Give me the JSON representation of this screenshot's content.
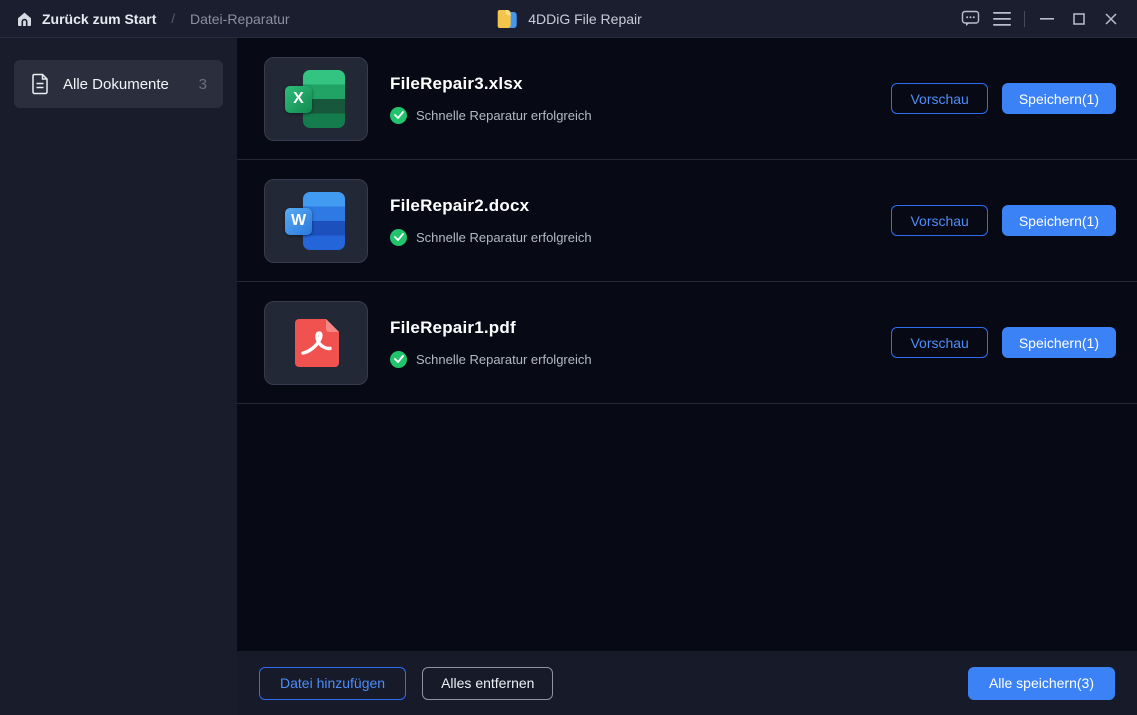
{
  "titlebar": {
    "back_label": "Zurück zum Start",
    "separator": "/",
    "current": "Datei-Reparatur",
    "app_title": "4DDiG File Repair"
  },
  "sidebar": {
    "all_documents_label": "Alle Dokumente",
    "all_documents_count": "3"
  },
  "files": [
    {
      "name": "FileRepair3.xlsx",
      "type": "xlsx",
      "badge_letter": "X",
      "status": "Schnelle Reparatur erfolgreich",
      "preview_label": "Vorschau",
      "save_label": "Speichern(1)"
    },
    {
      "name": "FileRepair2.docx",
      "type": "docx",
      "badge_letter": "W",
      "status": "Schnelle Reparatur erfolgreich",
      "preview_label": "Vorschau",
      "save_label": "Speichern(1)"
    },
    {
      "name": "FileRepair1.pdf",
      "type": "pdf",
      "badge_letter": "",
      "status": "Schnelle Reparatur erfolgreich",
      "preview_label": "Vorschau",
      "save_label": "Speichern(1)"
    }
  ],
  "footer": {
    "add_label": "Datei hinzufügen",
    "remove_label": "Alles entfernen",
    "save_all_label": "Alle speichern(3)"
  },
  "colors": {
    "accent": "#3b82f6",
    "success": "#21c46d",
    "excel": "#21a366",
    "word": "#2b7cd3",
    "pdf": "#f0534f"
  }
}
